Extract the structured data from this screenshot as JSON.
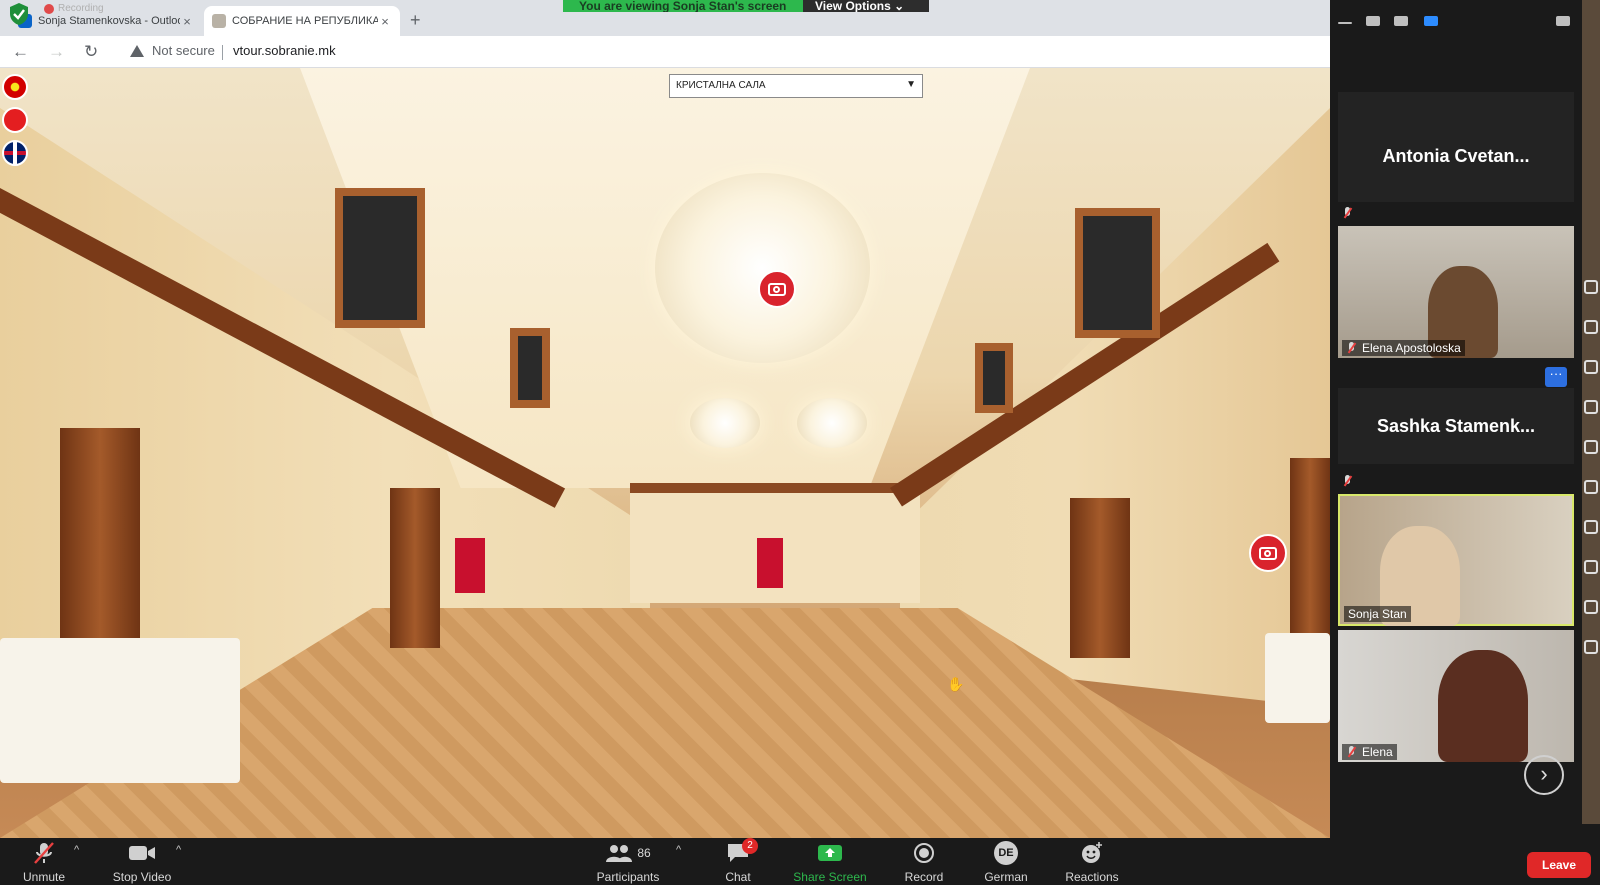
{
  "zoom": {
    "recording_label": "Recording",
    "view_banner": "You are viewing Sonja Stan's screen",
    "view_options": "View Options",
    "toolbar": {
      "unmute": "Unmute",
      "stop_video": "Stop Video",
      "participants": "Participants",
      "participants_count": "86",
      "chat": "Chat",
      "chat_badge": "2",
      "share_screen": "Share Screen",
      "record": "Record",
      "language": "German",
      "language_avatar": "DE",
      "reactions": "Reactions",
      "leave": "Leave"
    },
    "gallery": {
      "participants": [
        {
          "name": "Antonia  Cvetan...",
          "video": false,
          "muted": true
        },
        {
          "name": "Elena Apostoloska",
          "video": true,
          "muted": true
        },
        {
          "name": "Sashka  Stamenk...",
          "video": false,
          "muted": true
        },
        {
          "name": "Sonja Stan",
          "video": true,
          "muted": false,
          "active_speaker": true
        },
        {
          "name": "Elena",
          "video": true,
          "muted": true
        }
      ],
      "more_label": "···",
      "next_label": "›"
    },
    "colors": {
      "share_green": "#2db84d",
      "leave_red": "#e02828",
      "active_border": "#d8e86a"
    }
  },
  "browser": {
    "tabs": [
      {
        "label": "Sonja Stamenkovska - Outlook W",
        "close": "×"
      },
      {
        "label": "СОБРАНИЕ НА РЕПУБЛИКА СЕВЕР",
        "close": "×"
      }
    ],
    "new_tab": "+",
    "security": "Not secure",
    "url": "vtour.sobranie.mk"
  },
  "tour": {
    "room_select": "КРИСТАЛНА САЛА",
    "select_arrow": "▼",
    "language_flags": [
      "mk-flag-icon",
      "al-flag-icon",
      "uk-flag-icon"
    ]
  }
}
